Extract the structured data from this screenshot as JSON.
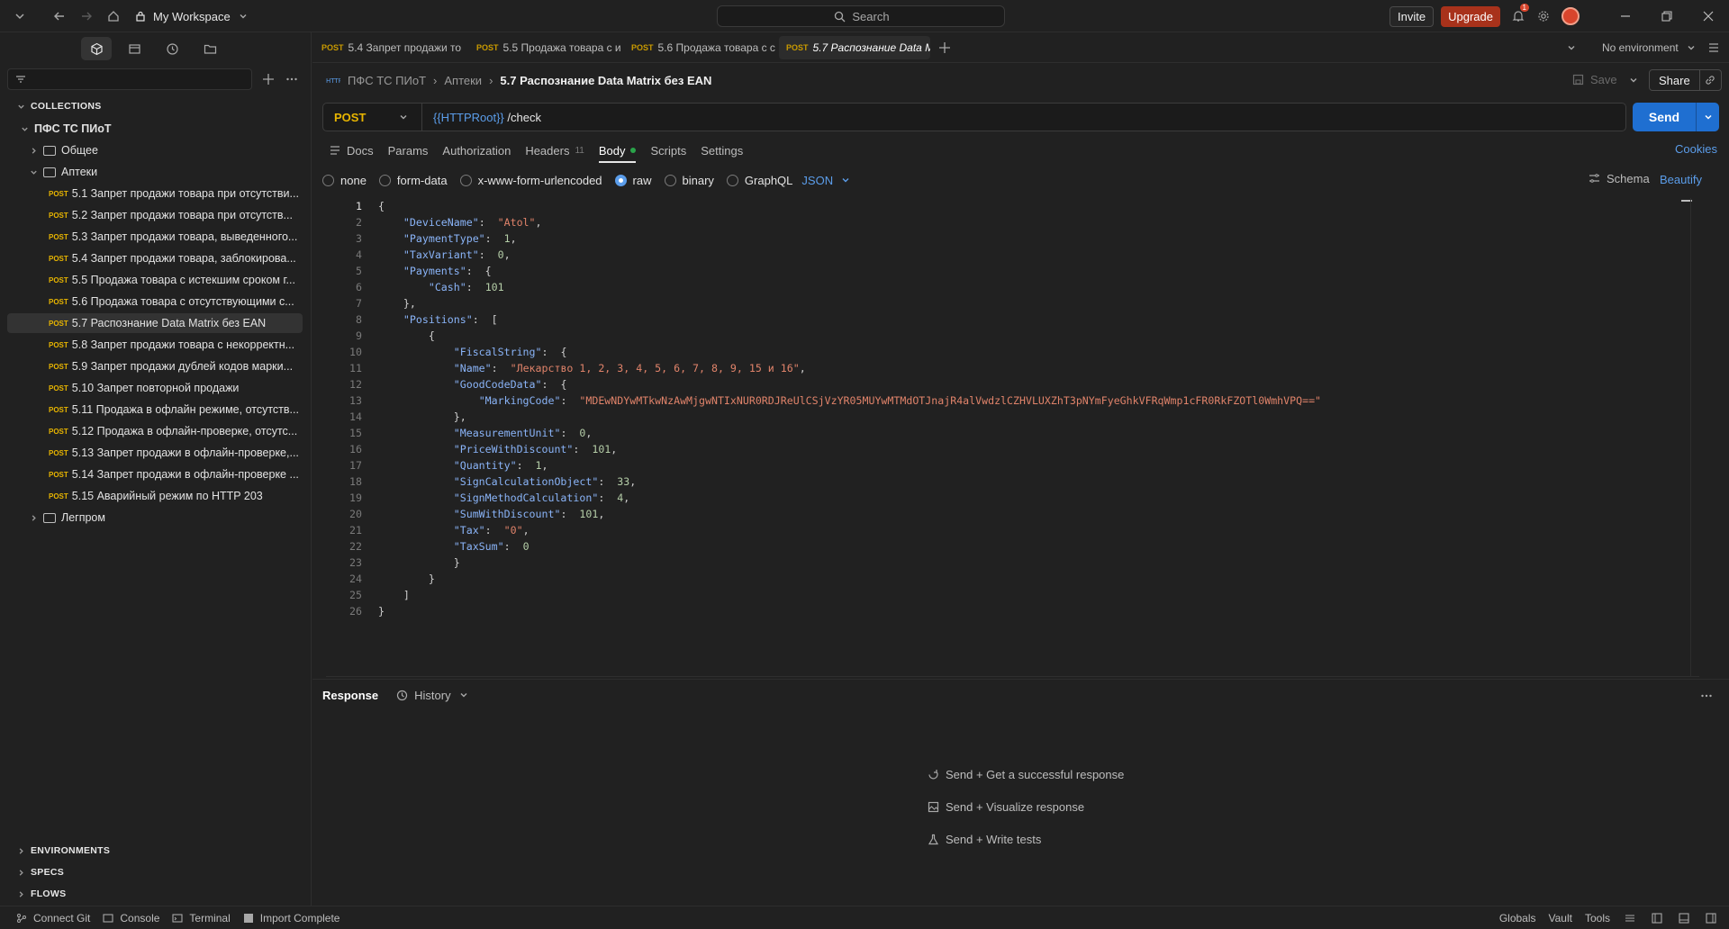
{
  "titlebar": {
    "workspace": "My Workspace",
    "search_placeholder": "Search",
    "invite": "Invite",
    "upgrade": "Upgrade",
    "notifications_count": "1"
  },
  "sidebar": {
    "collections_label": "COLLECTIONS",
    "root": "ПФС ТС ПИоТ",
    "folders": [
      "Общее",
      "Аптеки",
      "Легпром"
    ],
    "method_label": "POST",
    "requests": [
      "5.1 Запрет продажи товара при отсутстви...",
      "5.2 Запрет продажи товара при отсутств...",
      "5.3 Запрет продажи товара, выведенного...",
      "5.4 Запрет продажи товара, заблокирова...",
      "5.5 Продажа товара с истекшим сроком г...",
      "5.6 Продажа товара с отсутствующими с...",
      "5.7 Распознание Data Matrix без EAN",
      "5.8 Запрет продажи товара с некорректн...",
      "5.9 Запрет продажи дублей кодов марки...",
      "5.10 Запрет повторной продажи",
      "5.11 Продажа в офлайн режиме, отсутств...",
      "5.12 Продажа в офлайн-проверке, отсутс...",
      "5.13 Запрет продажи в офлайн-проверке,...",
      "5.14 Запрет продажи в офлайн-проверке ...",
      "5.15 Аварийный режим по HTTP 203"
    ],
    "bottom": [
      "ENVIRONMENTS",
      "SPECS",
      "FLOWS"
    ]
  },
  "tabs": {
    "items": [
      {
        "method": "POST",
        "label": "5.4 Запрет продажи то"
      },
      {
        "method": "POST",
        "label": "5.5 Продажа товара с и"
      },
      {
        "method": "POST",
        "label": "5.6 Продажа товара с с"
      },
      {
        "method": "POST",
        "label": "5.7 Распознание Data M"
      }
    ],
    "environment": "No environment"
  },
  "request": {
    "crumb_root": "ПФС ТС ПИоТ",
    "crumb_folder": "Аптеки",
    "crumb_current": "5.7 Распознание Data Matrix без EAN",
    "save": "Save",
    "share": "Share",
    "method": "POST",
    "url_var": "{{HTTPRoot}}",
    "url_path": " /check",
    "send": "Send",
    "tabs": [
      "Docs",
      "Params",
      "Authorization",
      "Headers",
      "Body",
      "Scripts",
      "Settings"
    ],
    "headers_count": "11",
    "cookies": "Cookies",
    "body_types": [
      "none",
      "form-data",
      "x-www-form-urlencoded",
      "raw",
      "binary",
      "GraphQL"
    ],
    "format": "JSON",
    "schema": "Schema",
    "beautify": "Beautify"
  },
  "code_lines": [
    [
      [
        "p",
        "{"
      ]
    ],
    [
      [
        "p",
        "    "
      ],
      [
        "k",
        "\"DeviceName\""
      ],
      [
        "p",
        ":  "
      ],
      [
        "s",
        "\"Atol\""
      ],
      [
        "p",
        ","
      ]
    ],
    [
      [
        "p",
        "    "
      ],
      [
        "k",
        "\"PaymentType\""
      ],
      [
        "p",
        ":  "
      ],
      [
        "n",
        "1"
      ],
      [
        "p",
        ","
      ]
    ],
    [
      [
        "p",
        "    "
      ],
      [
        "k",
        "\"TaxVariant\""
      ],
      [
        "p",
        ":  "
      ],
      [
        "n",
        "0"
      ],
      [
        "p",
        ","
      ]
    ],
    [
      [
        "p",
        "    "
      ],
      [
        "k",
        "\"Payments\""
      ],
      [
        "p",
        ":  {"
      ]
    ],
    [
      [
        "p",
        "        "
      ],
      [
        "k",
        "\"Cash\""
      ],
      [
        "p",
        ":  "
      ],
      [
        "n",
        "101"
      ]
    ],
    [
      [
        "p",
        "    },"
      ]
    ],
    [
      [
        "p",
        "    "
      ],
      [
        "k",
        "\"Positions\""
      ],
      [
        "p",
        ":  ["
      ]
    ],
    [
      [
        "p",
        "        {"
      ]
    ],
    [
      [
        "p",
        "            "
      ],
      [
        "k",
        "\"FiscalString\""
      ],
      [
        "p",
        ":  {"
      ]
    ],
    [
      [
        "p",
        "            "
      ],
      [
        "k",
        "\"Name\""
      ],
      [
        "p",
        ":  "
      ],
      [
        "s",
        "\"Лекарство 1, 2, 3, 4, 5, 6, 7, 8, 9, 15 и 16\""
      ],
      [
        "p",
        ","
      ]
    ],
    [
      [
        "p",
        "            "
      ],
      [
        "k",
        "\"GoodCodeData\""
      ],
      [
        "p",
        ":  {"
      ]
    ],
    [
      [
        "p",
        "                "
      ],
      [
        "k",
        "\"MarkingCode\""
      ],
      [
        "p",
        ":  "
      ],
      [
        "s",
        "\"MDEwNDYwMTkwNzAwMjgwNTIxNUR0RDJReUlCSjVzYR05MUYwMTMdOTJnajR4alVwdzlCZHVLUXZhT3pNYmFyeGhkVFRqWmp1cFR0RkFZOTl0WmhVPQ==\""
      ]
    ],
    [
      [
        "p",
        "            },"
      ]
    ],
    [
      [
        "p",
        "            "
      ],
      [
        "k",
        "\"MeasurementUnit\""
      ],
      [
        "p",
        ":  "
      ],
      [
        "n",
        "0"
      ],
      [
        "p",
        ","
      ]
    ],
    [
      [
        "p",
        "            "
      ],
      [
        "k",
        "\"PriceWithDiscount\""
      ],
      [
        "p",
        ":  "
      ],
      [
        "n",
        "101"
      ],
      [
        "p",
        ","
      ]
    ],
    [
      [
        "p",
        "            "
      ],
      [
        "k",
        "\"Quantity\""
      ],
      [
        "p",
        ":  "
      ],
      [
        "n",
        "1"
      ],
      [
        "p",
        ","
      ]
    ],
    [
      [
        "p",
        "            "
      ],
      [
        "k",
        "\"SignCalculationObject\""
      ],
      [
        "p",
        ":  "
      ],
      [
        "n",
        "33"
      ],
      [
        "p",
        ","
      ]
    ],
    [
      [
        "p",
        "            "
      ],
      [
        "k",
        "\"SignMethodCalculation\""
      ],
      [
        "p",
        ":  "
      ],
      [
        "n",
        "4"
      ],
      [
        "p",
        ","
      ]
    ],
    [
      [
        "p",
        "            "
      ],
      [
        "k",
        "\"SumWithDiscount\""
      ],
      [
        "p",
        ":  "
      ],
      [
        "n",
        "101"
      ],
      [
        "p",
        ","
      ]
    ],
    [
      [
        "p",
        "            "
      ],
      [
        "k",
        "\"Tax\""
      ],
      [
        "p",
        ":  "
      ],
      [
        "s",
        "\"0\""
      ],
      [
        "p",
        ","
      ]
    ],
    [
      [
        "p",
        "            "
      ],
      [
        "k",
        "\"TaxSum\""
      ],
      [
        "p",
        ":  "
      ],
      [
        "n",
        "0"
      ]
    ],
    [
      [
        "p",
        "            }"
      ]
    ],
    [
      [
        "p",
        "        }"
      ]
    ],
    [
      [
        "p",
        "    ]"
      ]
    ],
    [
      [
        "p",
        "}"
      ]
    ]
  ],
  "response": {
    "label": "Response",
    "history": "History",
    "hints": [
      "Send + Get a successful response",
      "Send + Visualize response",
      "Send + Write tests"
    ]
  },
  "statusbar": {
    "left": [
      "Connect Git",
      "Console",
      "Terminal",
      "Import Complete"
    ],
    "right": [
      "Globals",
      "Vault",
      "Tools"
    ]
  }
}
